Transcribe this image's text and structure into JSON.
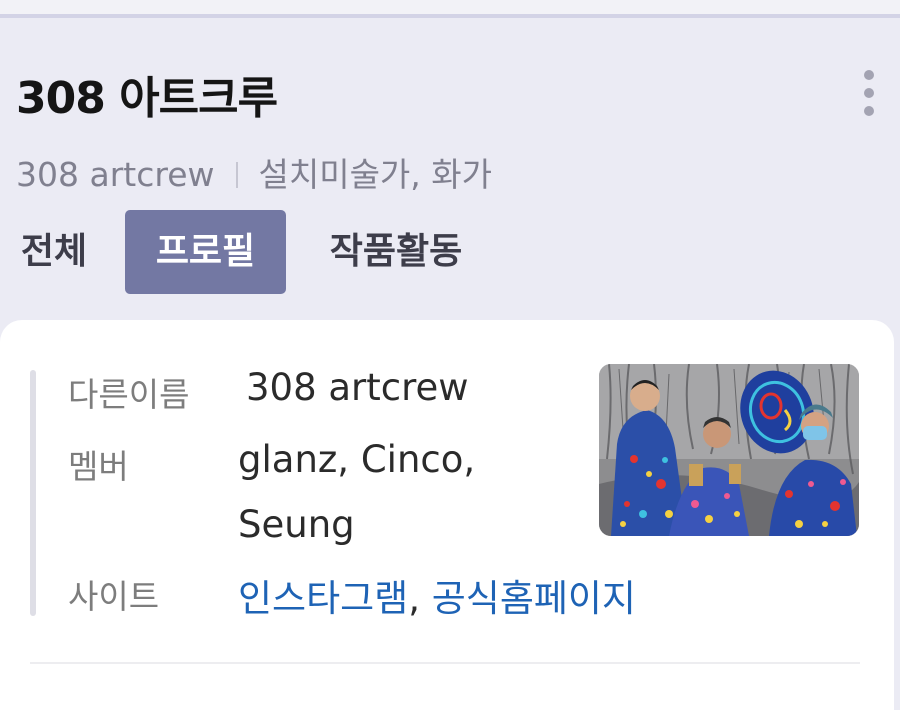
{
  "header": {
    "title": "308 아트크루",
    "subtitle_name": "308 artcrew",
    "subtitle_role": "설치미술가, 화가",
    "more_icon": "more-vertical-icon"
  },
  "tabs": [
    {
      "label": "전체",
      "active": false
    },
    {
      "label": "프로필",
      "active": true
    },
    {
      "label": "작품활동",
      "active": false
    }
  ],
  "profile": {
    "alias_label": "다른이름",
    "alias_value": "308 artcrew",
    "members_label": "멤버",
    "members_line1": "glanz, Cinco,",
    "members_line2": "Seung",
    "site_label": "사이트",
    "site_links": [
      "인스타그램",
      "공식홈페이지"
    ],
    "site_separator": ","
  },
  "colors": {
    "accent_tab": "#7378a3",
    "link": "#1e63b5",
    "background": "#ebebf4"
  }
}
